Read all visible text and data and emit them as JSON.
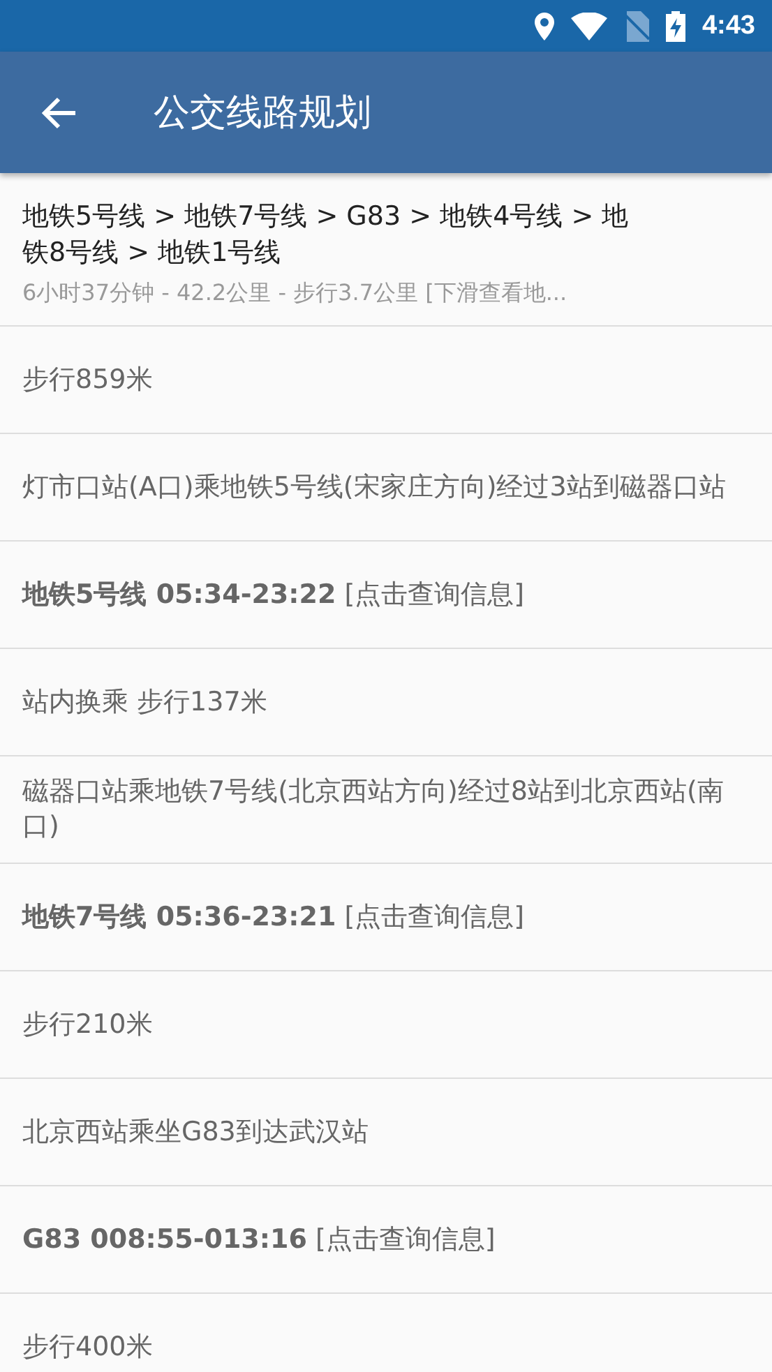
{
  "status_bar": {
    "time": "4:43"
  },
  "app_bar": {
    "title": "公交线路规划"
  },
  "summary": {
    "route": "地铁5号线 > 地铁7号线 > G83 > 地铁4号线 > 地铁8号线 > 地铁1号线",
    "details": "6小时37分钟 - 42.2公里 - 步行3.7公里  [下滑查看地..."
  },
  "steps": [
    {
      "text": "步行859米"
    },
    {
      "text": "灯市口站(A口)乘地铁5号线(宋家庄方向)经过3站到磁器口站"
    },
    {
      "text": "**地铁5号线 05:34-23:22** [点击查询信息]"
    },
    {
      "text": "站内换乘 步行137米"
    },
    {
      "text": "磁器口站乘地铁7号线(北京西站方向)经过8站到北京西站(南口)"
    },
    {
      "text": "**地铁7号线 05:36-23:21** [点击查询信息]"
    },
    {
      "text": "步行210米"
    },
    {
      "text": "北京西站乘坐G83到达武汉站"
    },
    {
      "text": "**G83 008:55-013:16** [点击查询信息]"
    },
    {
      "text": "步行400米"
    }
  ]
}
